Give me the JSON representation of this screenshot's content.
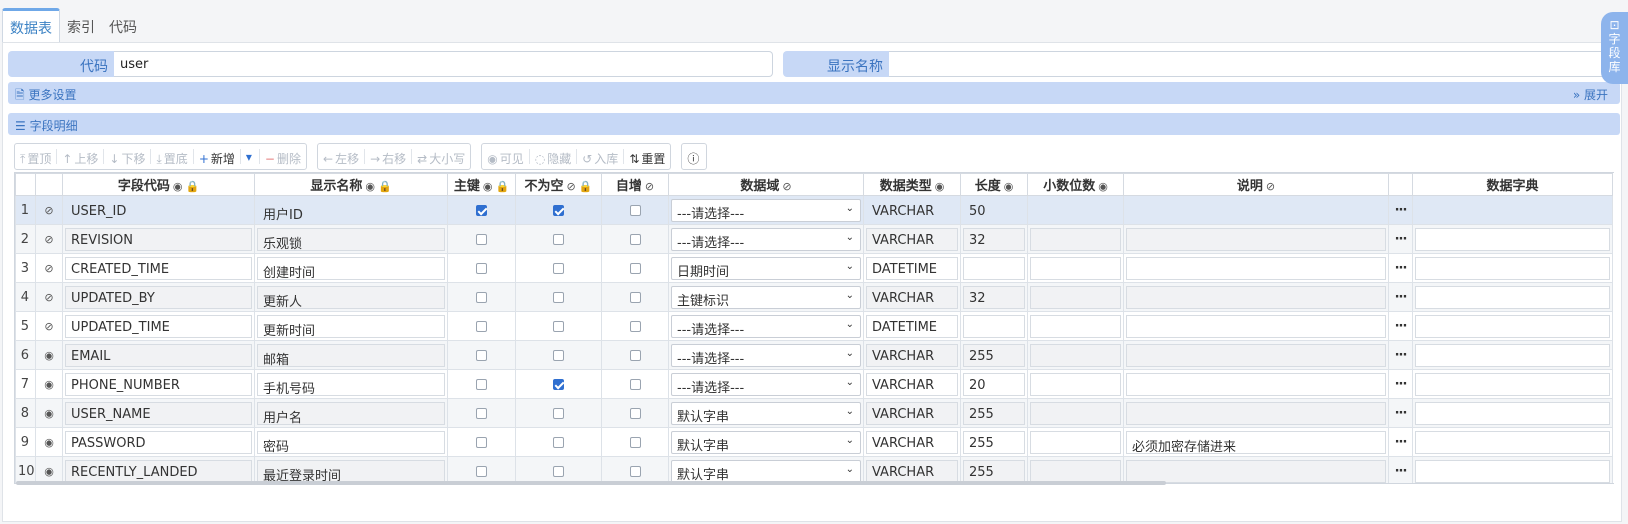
{
  "tabs": [
    {
      "label": "数据表",
      "active": true
    },
    {
      "label": "索引",
      "active": false
    },
    {
      "label": "代码",
      "active": false
    }
  ],
  "form": {
    "code_label": "代码",
    "code_value": "user",
    "display_name_label": "显示名称",
    "display_name_value": ""
  },
  "more_settings": {
    "label": "更多设置",
    "expand_label": "展开"
  },
  "field_details": {
    "label": "字段明细"
  },
  "toolbar": {
    "groups": [
      [
        {
          "label": "置顶",
          "icon": "arrow-top-icon",
          "glyph": "⤒",
          "enabled": false
        },
        {
          "label": "上移",
          "icon": "arrow-up-icon",
          "glyph": "↑",
          "enabled": false
        },
        {
          "label": "下移",
          "icon": "arrow-down-icon",
          "glyph": "↓",
          "enabled": false
        },
        {
          "label": "置底",
          "icon": "arrow-bottom-icon",
          "glyph": "⤓",
          "enabled": false
        },
        {
          "label": "新增",
          "icon": "plus-icon",
          "glyph": "+",
          "enabled": true
        },
        {
          "label": "",
          "icon": "caret-down-icon",
          "glyph": "▾",
          "enabled": true
        },
        {
          "label": "删除",
          "icon": "minus-icon",
          "glyph": "−",
          "enabled": false
        }
      ],
      [
        {
          "label": "左移",
          "icon": "arrow-left-icon",
          "glyph": "←",
          "enabled": false
        },
        {
          "label": "右移",
          "icon": "arrow-right-icon",
          "glyph": "→",
          "enabled": false
        },
        {
          "label": "大小写",
          "icon": "swap-icon",
          "glyph": "⇄",
          "enabled": false
        }
      ],
      [
        {
          "label": "可见",
          "icon": "eye-icon",
          "glyph": "◉",
          "enabled": false
        },
        {
          "label": "隐藏",
          "icon": "eye-off-icon",
          "glyph": "◌",
          "enabled": false
        },
        {
          "label": "入库",
          "icon": "import-icon",
          "glyph": "↺",
          "enabled": false
        },
        {
          "label": "重置",
          "icon": "sort-icon",
          "glyph": "⇅",
          "enabled": true
        }
      ],
      [
        {
          "label": "",
          "icon": "info-icon",
          "glyph": "ⓘ",
          "enabled": true
        }
      ]
    ]
  },
  "columns": [
    {
      "label": "",
      "w": 20
    },
    {
      "label": "",
      "w": 27
    },
    {
      "label": "字段代码",
      "w": 192,
      "icons": [
        "eye-icon",
        "lock-icon"
      ]
    },
    {
      "label": "显示名称",
      "w": 193,
      "icons": [
        "eye-icon",
        "lock-icon"
      ]
    },
    {
      "label": "主键",
      "w": 68,
      "icons": [
        "eye-icon",
        "lock-icon"
      ]
    },
    {
      "label": "不为空",
      "w": 86,
      "icons": [
        "eye-off-icon",
        "lock-icon"
      ]
    },
    {
      "label": "自增",
      "w": 67,
      "icons": [
        "eye-off-icon"
      ]
    },
    {
      "label": "数据域",
      "w": 195,
      "icons": [
        "eye-off-icon"
      ]
    },
    {
      "label": "数据类型",
      "w": 97,
      "icons": [
        "eye-icon"
      ]
    },
    {
      "label": "长度",
      "w": 67,
      "icons": [
        "eye-icon"
      ]
    },
    {
      "label": "小数位数",
      "w": 96,
      "icons": [
        "eye-icon"
      ]
    },
    {
      "label": "说明",
      "w": 265,
      "icons": [
        "eye-off-icon"
      ]
    },
    {
      "label": "",
      "w": 24
    },
    {
      "label": "数据字典",
      "w": 200
    }
  ],
  "rows": [
    {
      "n": "1",
      "vis": "eye-off-icon",
      "code": "USER_ID",
      "name": "用户ID",
      "pk": true,
      "nn": true,
      "ai": false,
      "domain": "---请选择---",
      "type": "VARCHAR",
      "len": "50",
      "dec": "",
      "desc": ""
    },
    {
      "n": "2",
      "vis": "eye-off-icon",
      "code": "REVISION",
      "name": "乐观锁",
      "pk": false,
      "nn": false,
      "ai": false,
      "domain": "---请选择---",
      "type": "VARCHAR",
      "len": "32",
      "dec": "",
      "desc": ""
    },
    {
      "n": "3",
      "vis": "eye-off-icon",
      "code": "CREATED_TIME",
      "name": "创建时间",
      "pk": false,
      "nn": false,
      "ai": false,
      "domain": "日期时间",
      "type": "DATETIME",
      "len": "",
      "dec": "",
      "desc": ""
    },
    {
      "n": "4",
      "vis": "eye-off-icon",
      "code": "UPDATED_BY",
      "name": "更新人",
      "pk": false,
      "nn": false,
      "ai": false,
      "domain": "主键标识",
      "type": "VARCHAR",
      "len": "32",
      "dec": "",
      "desc": ""
    },
    {
      "n": "5",
      "vis": "eye-off-icon",
      "code": "UPDATED_TIME",
      "name": "更新时间",
      "pk": false,
      "nn": false,
      "ai": false,
      "domain": "---请选择---",
      "type": "DATETIME",
      "len": "",
      "dec": "",
      "desc": ""
    },
    {
      "n": "6",
      "vis": "eye-icon",
      "code": "EMAIL",
      "name": "邮箱",
      "pk": false,
      "nn": false,
      "ai": false,
      "domain": "---请选择---",
      "type": "VARCHAR",
      "len": "255",
      "dec": "",
      "desc": ""
    },
    {
      "n": "7",
      "vis": "eye-icon",
      "code": "PHONE_NUMBER",
      "name": "手机号码",
      "pk": false,
      "nn": true,
      "ai": false,
      "domain": "---请选择---",
      "type": "VARCHAR",
      "len": "20",
      "dec": "",
      "desc": ""
    },
    {
      "n": "8",
      "vis": "eye-icon",
      "code": "USER_NAME",
      "name": "用户名",
      "pk": false,
      "nn": false,
      "ai": false,
      "domain": "默认字串",
      "type": "VARCHAR",
      "len": "255",
      "dec": "",
      "desc": ""
    },
    {
      "n": "9",
      "vis": "eye-icon",
      "code": "PASSWORD",
      "name": "密码",
      "pk": false,
      "nn": false,
      "ai": false,
      "domain": "默认字串",
      "type": "VARCHAR",
      "len": "255",
      "dec": "",
      "desc": "必须加密存储进来"
    },
    {
      "n": "10",
      "vis": "eye-icon",
      "code": "RECENTLY_LANDED",
      "name": "最近登录时间",
      "pk": false,
      "nn": false,
      "ai": false,
      "domain": "默认字串",
      "type": "VARCHAR",
      "len": "255",
      "dec": "",
      "desc": ""
    }
  ],
  "side_tab": {
    "chars": [
      "字",
      "段",
      "库"
    ]
  }
}
